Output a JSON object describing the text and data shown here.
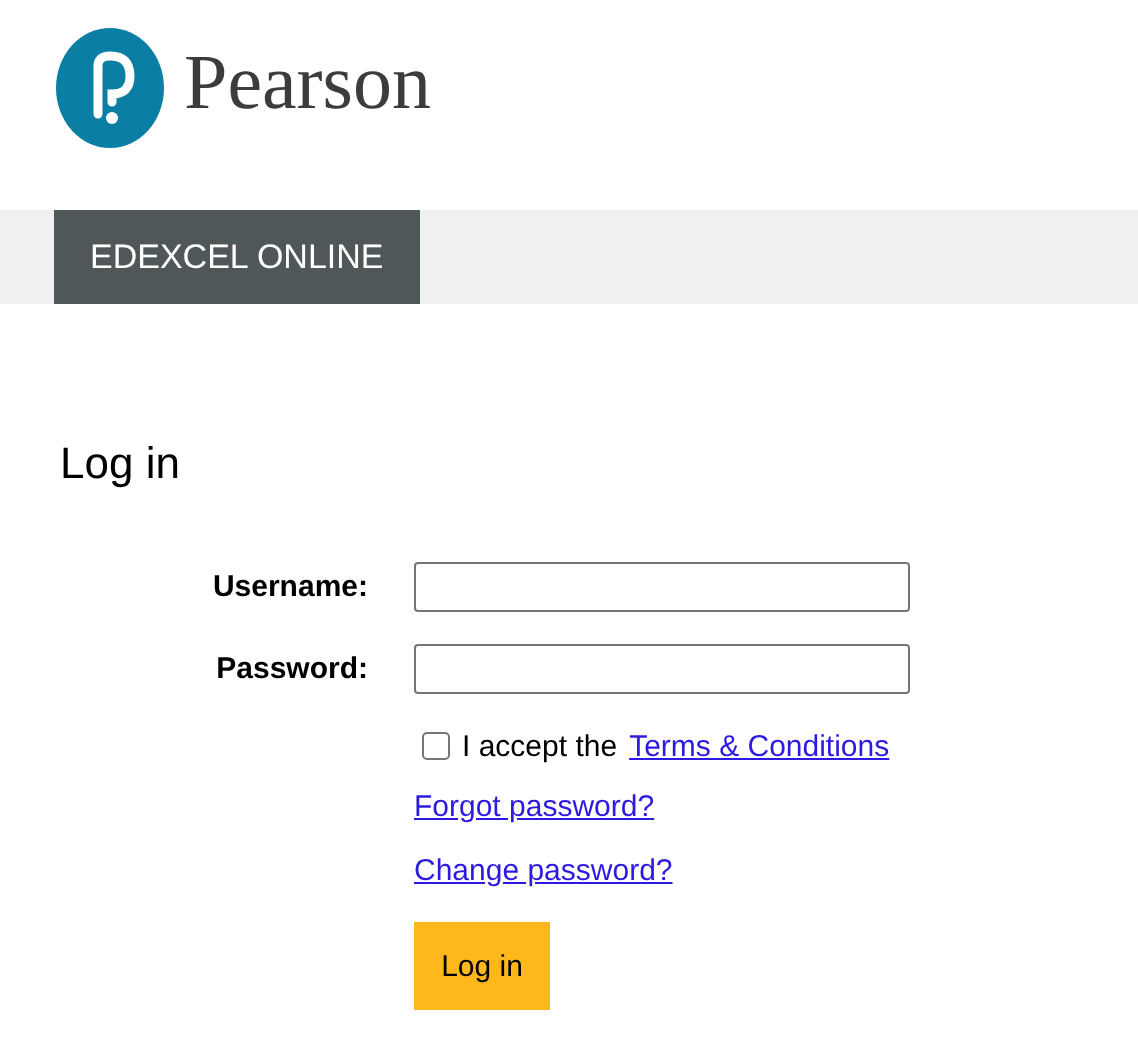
{
  "logo": {
    "wordmark": "Pearson"
  },
  "nav": {
    "tabs": [
      {
        "label": "EDEXCEL ONLINE",
        "selected": true
      }
    ]
  },
  "heading": "Log in",
  "form": {
    "fields": [
      {
        "label": "Username:"
      },
      {
        "label": "Password:"
      }
    ],
    "terms": {
      "checked": false,
      "text": "I accept the",
      "link": "Terms & Conditions"
    },
    "links": [
      "Forgot password?",
      "Change password?"
    ],
    "submit": "Log in"
  }
}
